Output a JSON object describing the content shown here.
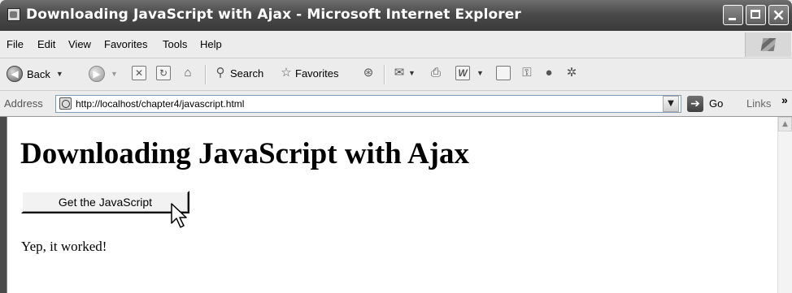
{
  "window": {
    "title": "Downloading JavaScript with Ajax - Microsoft Internet Explorer",
    "controls": {
      "close_glyph": "×"
    }
  },
  "menu": {
    "items": [
      "File",
      "Edit",
      "View",
      "Favorites",
      "Tools",
      "Help"
    ]
  },
  "toolbar": {
    "back_label": "Back",
    "search_label": "Search",
    "favorites_label": "Favorites",
    "icons": [
      "back-icon",
      "forward-icon",
      "stop-icon",
      "refresh-icon",
      "home-icon",
      "search-icon",
      "favorites-star-icon",
      "history-icon",
      "mail-icon",
      "print-icon",
      "edit-word-icon",
      "discuss-icon",
      "research-icon",
      "messenger-icon",
      "tools-icon"
    ]
  },
  "address": {
    "label": "Address",
    "url": "http://localhost/chapter4/javascript.html",
    "go_label": "Go",
    "links_label": "Links",
    "links_more": "»"
  },
  "page": {
    "heading": "Downloading JavaScript with Ajax",
    "button_label": "Get the JavaScript",
    "result": "Yep, it worked!"
  },
  "colors": {
    "titlebar": "#4a4a4a",
    "chrome": "#ececec",
    "content_bg": "#ffffff"
  }
}
